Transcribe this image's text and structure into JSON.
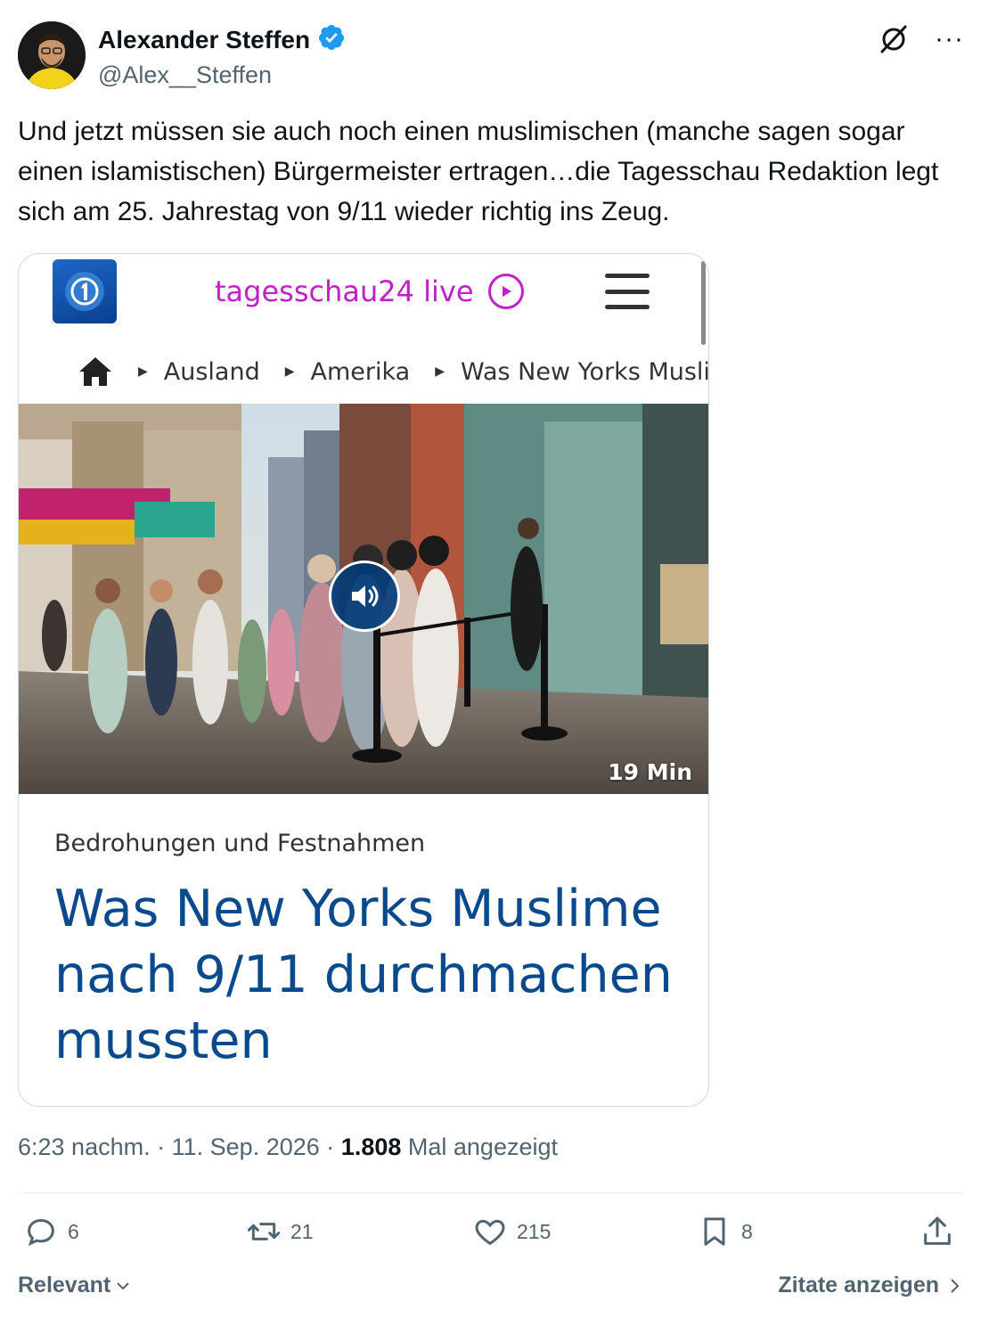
{
  "author": {
    "name": "Alexander Steffen",
    "handle": "@Alex__Steffen",
    "verified": true,
    "verified_color": "#1d9bf0"
  },
  "header_icons": [
    "grok-icon",
    "more-icon"
  ],
  "more_label": "···",
  "tweet_text": "Und jetzt müssen sie auch noch einen muslimischen (manche sagen sogar einen islamistischen) Bürgermeister ertragen…die Tagesschau Redaktion legt sich am 25. Jahrestag von 9/11 wieder richtig ins Zeug.",
  "media": {
    "site_label": "tagesschau24 live",
    "site_color": "#c21ecb",
    "breadcrumbs": [
      "Ausland",
      "Amerika",
      "Was New Yorks Musli"
    ],
    "duration": "19 Min",
    "kicker": "Bedrohungen und Festnahmen",
    "headline": "Was New Yorks Muslime nach 9/11 durchmachen mussten",
    "headline_color": "#0a4a8c"
  },
  "meta": {
    "time": "6:23 nachm.",
    "separator": "·",
    "date": "11. Sep. 2026",
    "views": "1.808",
    "views_label": "Mal angezeigt"
  },
  "actions": {
    "replies": "6",
    "reposts": "21",
    "likes": "215",
    "bookmarks": "8"
  },
  "footer": {
    "sort_label": "Relevant",
    "quotes_label": "Zitate anzeigen"
  }
}
